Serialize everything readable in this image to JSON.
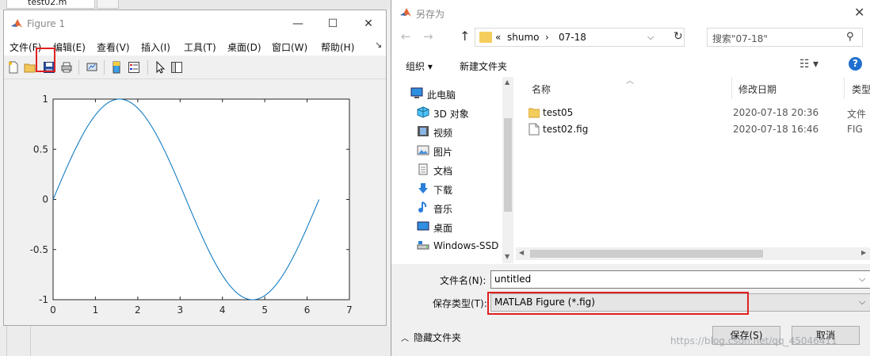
{
  "background": {
    "editor_tab": "test02.m"
  },
  "figure_window": {
    "title": "Figure 1",
    "window_buttons": {
      "minimize": "—",
      "maximize": "☐",
      "close": "✕"
    },
    "menu": [
      "文件(F)",
      "编辑(E)",
      "查看(V)",
      "插入(I)",
      "工具(T)",
      "桌面(D)",
      "窗口(W)",
      "帮助(H)"
    ],
    "menu_more": "↘",
    "toolbar_icons": [
      "new-figure-icon",
      "open-folder-icon",
      "save-icon",
      "print-icon",
      "link-plot-icon",
      "colorbar-icon",
      "legend-icon",
      "pointer-icon",
      "property-editor-icon"
    ],
    "highlight_color": "#e02020"
  },
  "chart_data": {
    "type": "line",
    "function": "sin(x)",
    "x_range": [
      0,
      6.283
    ],
    "xlim": [
      0,
      7
    ],
    "ylim": [
      -1,
      1
    ],
    "x_ticks": [
      "0",
      "1",
      "2",
      "3",
      "4",
      "5",
      "6",
      "7"
    ],
    "y_ticks": [
      "1",
      "0.5",
      "0",
      "-0.5",
      "-1"
    ],
    "x_tick_values": [
      0,
      1,
      2,
      3,
      4,
      5,
      6,
      7
    ],
    "y_tick_values": [
      1,
      0.5,
      0,
      -0.5,
      -1
    ],
    "series": [
      {
        "color": "#0072bd"
      }
    ],
    "grid": false
  },
  "dialog": {
    "title": "另存为",
    "close": "✕",
    "nav": {
      "back": "←",
      "forward": "→",
      "up": "↑"
    },
    "address": {
      "overflow": "«",
      "crumb1": "shumo",
      "sep": "›",
      "crumb2": "07-18",
      "chevron": "⌵",
      "refresh": "↻"
    },
    "search_placeholder": "搜索\"07-18\"",
    "search_icon": "⚲",
    "organize": "组织 ▾",
    "new_folder": "新建文件夹",
    "view_icon": "☷ ▾",
    "help": "?",
    "nav_items": [
      {
        "label": "此电脑",
        "icon": "computer-icon"
      },
      {
        "label": "3D 对象",
        "icon": "3d-objects-icon"
      },
      {
        "label": "视频",
        "icon": "video-icon"
      },
      {
        "label": "图片",
        "icon": "pictures-icon"
      },
      {
        "label": "文档",
        "icon": "documents-icon"
      },
      {
        "label": "下载",
        "icon": "downloads-icon"
      },
      {
        "label": "音乐",
        "icon": "music-icon"
      },
      {
        "label": "桌面",
        "icon": "desktop-icon"
      },
      {
        "label": "Windows-SSD",
        "icon": "drive-icon"
      }
    ],
    "columns": {
      "name": "名称",
      "date": "修改日期",
      "type": "类型"
    },
    "files": [
      {
        "name": "test05",
        "date": "2020-07-18 20:36",
        "type": "文件",
        "icon": "folder-icon"
      },
      {
        "name": "test02.fig",
        "date": "2020-07-18 16:46",
        "type": "FIG",
        "icon": "file-icon"
      }
    ],
    "filename_label": "文件名(N):",
    "filename_value": "untitled",
    "filetype_label": "保存类型(T):",
    "filetype_value": "MATLAB Figure (*.fig)",
    "hide_folders": "隐藏文件夹",
    "save_button": "保存(S)",
    "cancel_button": "取消",
    "watermark": "https://blog.csdn.net/qq_45046411"
  }
}
